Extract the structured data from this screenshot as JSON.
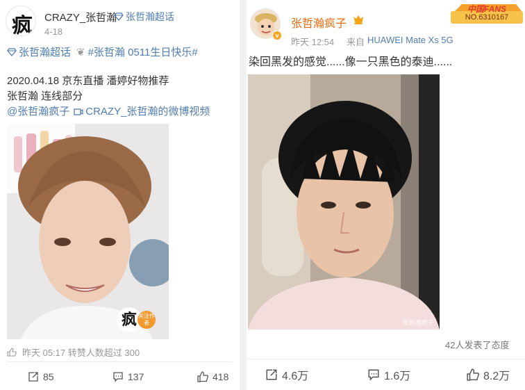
{
  "left_post": {
    "author": "CRAZY_张哲瀚",
    "badge": "张哲瀚超话",
    "avatar_char": "疯",
    "date": "4-18",
    "topic_tag": "张哲瀚超话",
    "hashtag": "#张哲瀚 0511生日快乐#",
    "line1": "2020.04.18 京东直播 潘婷好物推荐",
    "line2": "张哲瀚 连线部分",
    "mention": "@张哲瀚疯子",
    "video_link": "CRAZY_张哲瀚的微博视频",
    "follow_badge": "关注作者",
    "footer": "昨天 05:17 转赞人数超过 300",
    "reposts": "85",
    "comments": "137",
    "likes": "418"
  },
  "right_post": {
    "author": "张哲瀚疯子",
    "time": "昨天 12:54",
    "source_prefix": "来自",
    "source_device": "HUAWEI Mate Xs 5G",
    "fans_title": "中国FANS",
    "fans_no": "NO.6310167",
    "text": "染回黑发的感觉......像一只黑色的泰迪......",
    "watermark": "张哲瀚疯子",
    "attitude": "42人发表了态度",
    "reposts": "4.6万",
    "comments": "1.6万",
    "likes": "8.2万"
  },
  "colors": {
    "link_blue": "#507daf",
    "name_orange": "#e86b0f",
    "fans_red": "#e23b2e"
  }
}
